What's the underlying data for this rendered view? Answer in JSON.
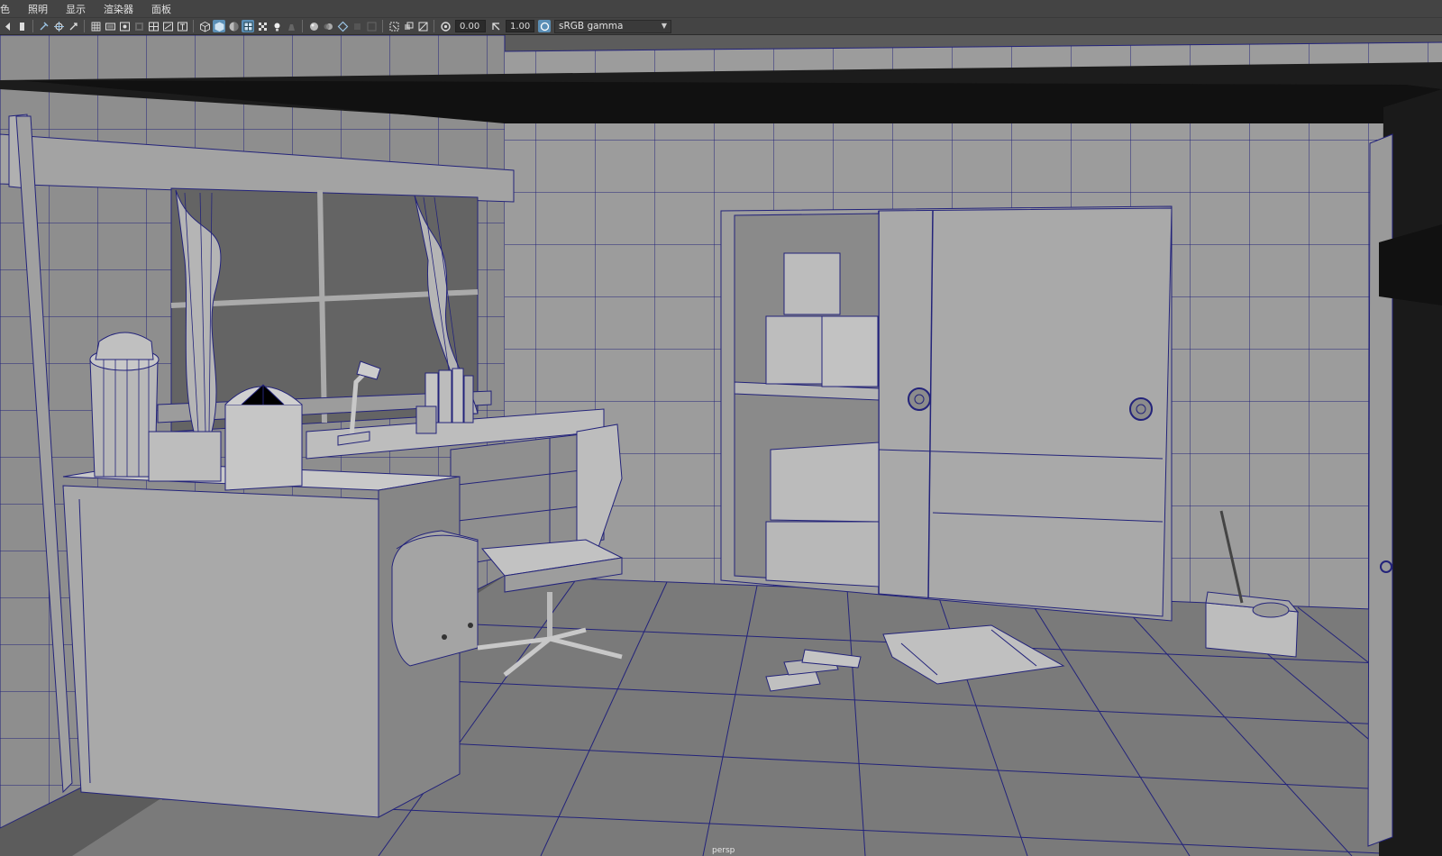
{
  "menus": [
    "色",
    "照明",
    "显示",
    "渲染器",
    "面板"
  ],
  "toolbar": {
    "exposure_value": "0.00",
    "gamma_value": "1.00",
    "color_space": "sRGB gamma",
    "icons": [
      "select-camera-icon",
      "camera-attributes-icon",
      "bookmark-icon",
      "tumble-tool-icon",
      "track-tool-icon",
      "dolly-tool-icon",
      "grid-icon",
      "film-gate-icon",
      "resolution-gate-icon",
      "gate-mask-icon",
      "field-chart-icon",
      "safe-action-icon",
      "safe-title-icon",
      "wireframe-icon",
      "smooth-shade-icon",
      "default-material-icon",
      "wireframe-on-shaded-icon",
      "textured-icon",
      "use-all-lights-icon",
      "shadows-icon",
      "screen-space-ao-icon",
      "motion-blur-icon",
      "multisample-aa-icon",
      "depth-of-field-icon",
      "isolate-select-icon",
      "xray-icon",
      "xray-joints-icon",
      "xray-components-icon",
      "exposure-icon",
      "gamma-icon",
      "color-management-icon"
    ]
  },
  "viewport": {
    "camera": "persp",
    "background_color": "#5a5a5a",
    "wireframe_color": "#1a1a8c",
    "geometry_color": "#9a9a9a"
  }
}
